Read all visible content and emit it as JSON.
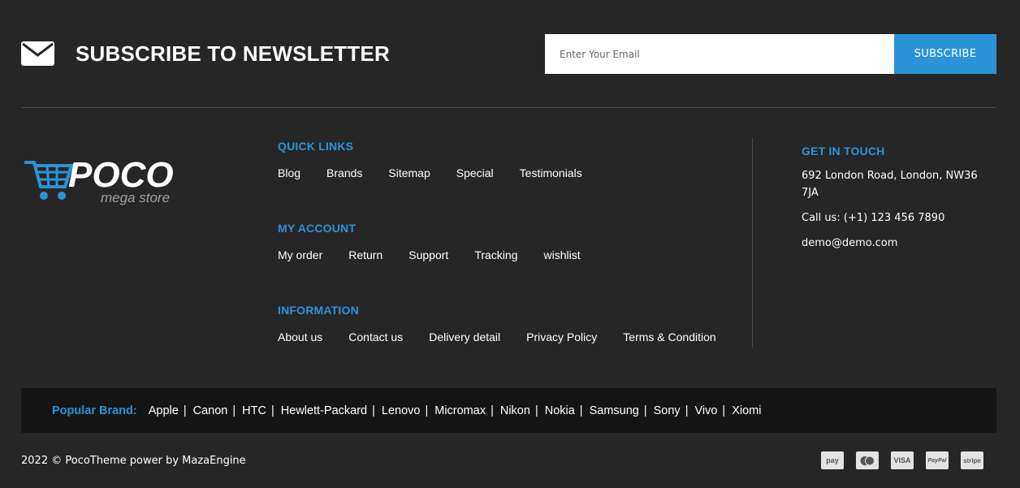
{
  "newsletter": {
    "title": "SUBSCRIBE TO NEWSLETTER",
    "email_placeholder": "Enter Your Email",
    "subscribe_label": "SUBSCRIBE"
  },
  "logo": {
    "brand": "POCO",
    "tagline": "mega store"
  },
  "quick_links": {
    "title": "QUICK LINKS",
    "items": [
      "Blog",
      "Brands",
      "Sitemap",
      "Special",
      "Testimonials"
    ]
  },
  "my_account": {
    "title": "MY ACCOUNT",
    "items": [
      "My order",
      "Return",
      "Support",
      "Tracking",
      "wishlist"
    ]
  },
  "information": {
    "title": "INFORMATION",
    "items": [
      "About us",
      "Contact us",
      "Delivery detail",
      "Privacy Policy",
      "Terms & Condition"
    ]
  },
  "contact": {
    "title": "GET IN TOUCH",
    "address": "692 London Road, London, NW36 7JA",
    "phone": "Call us: (+1) 123 456 7890",
    "email": "demo@demo.com"
  },
  "brands": {
    "label": "Popular Brand:",
    "items": [
      "Apple",
      "Canon",
      "HTC",
      "Hewlett-Packard",
      "Lenovo",
      "Micromax",
      "Nikon",
      "Nokia",
      "Samsung",
      "Sony",
      "Vivo",
      "Xiomi"
    ],
    "separator": "|"
  },
  "copyright": "2022 © PocoTheme power by MazaEngine",
  "payments": [
    {
      "icon": "amazon-pay-icon",
      "label": "pay"
    },
    {
      "icon": "mastercard-icon",
      "label": ""
    },
    {
      "icon": "visa-icon",
      "label": "VISA"
    },
    {
      "icon": "paypal-icon",
      "label": "PayPal"
    },
    {
      "icon": "stripe-icon",
      "label": "stripe"
    }
  ],
  "colors": {
    "background": "#262627",
    "accent": "#2a93d8",
    "brand_bar": "#151515"
  }
}
